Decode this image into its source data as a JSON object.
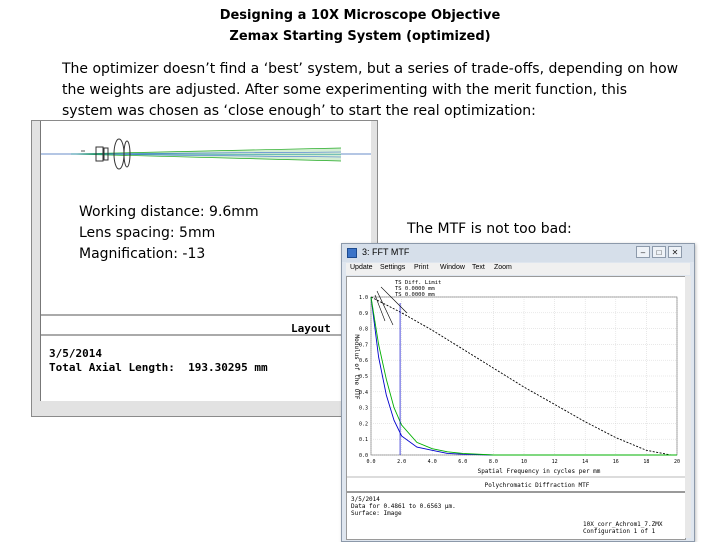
{
  "slide": {
    "title_line1": "Designing a 10X Microscope Objective",
    "title_line2": "Zemax Starting System (optimized)",
    "paragraph": "The optimizer doesn’t find a ‘best’ system, but a series of trade-offs, depending on how the weights are adjusted.  After some experimenting with the merit function, this system was chosen as ‘close enough’ to start the real optimization:",
    "specs": [
      "Working distance:  9.6mm",
      "Lens spacing:  5mm",
      "Magnification: -13"
    ],
    "mtf_caption": "The MTF is not too bad:"
  },
  "layout_window": {
    "label": "Layout",
    "date": "3/5/2014",
    "length_label": "Total Axial Length:",
    "length_value": "193.30295 mm"
  },
  "mtf_window": {
    "title": "3: FFT MTF",
    "menu": [
      "Update",
      "Settings",
      "Print",
      "Window",
      "Text",
      "Zoom"
    ],
    "controls": {
      "minimize": "–",
      "maximize": "□",
      "close": "✕"
    },
    "plot_title": "Polychromatic Diffraction MTF",
    "xlabel": "Spatial Frequency in cycles per mm",
    "ylabel": "Modulus of the OTF",
    "legend": [
      "TS Diff. Limit",
      "TS 0.0000 mm",
      "TS 0.0000 mm"
    ],
    "info": {
      "date": "3/5/2014",
      "line2": "Data for 0.4861 to 0.6563 µm.",
      "line3": "Surface: Image",
      "file": "10X_corr_Achrom1_7.ZMX",
      "config": "Configuration 1 of 1"
    }
  },
  "chart_data": {
    "type": "line",
    "title": "Polychromatic Diffraction MTF",
    "xlabel": "Spatial Frequency in cycles per mm",
    "ylabel": "Modulus of the OTF",
    "xlim": [
      0,
      20
    ],
    "ylim": [
      0,
      1
    ],
    "xticks": [
      "0.0",
      "2.0",
      "4.0",
      "6.0",
      "8.0",
      "10",
      "12",
      "14",
      "16",
      "18",
      "20"
    ],
    "yticks": [
      "0.0",
      "0.1",
      "0.2",
      "0.3",
      "0.4",
      "0.5",
      "0.6",
      "0.7",
      "0.8",
      "0.9",
      "1.0"
    ],
    "series": [
      {
        "name": "TS Diff. Limit",
        "color": "#000000",
        "style": "dashed",
        "x": [
          0,
          2,
          4,
          6,
          8,
          10,
          12,
          14,
          16,
          18,
          19.6
        ],
        "y": [
          1.0,
          0.9,
          0.79,
          0.67,
          0.55,
          0.43,
          0.32,
          0.21,
          0.11,
          0.03,
          0.0
        ]
      },
      {
        "name": "TS 0.0000 mm",
        "color": "#0000cc",
        "style": "solid",
        "x": [
          0,
          0.5,
          1,
          1.5,
          2,
          3,
          4,
          5,
          6,
          8,
          10,
          20
        ],
        "y": [
          1.0,
          0.62,
          0.38,
          0.22,
          0.12,
          0.05,
          0.03,
          0.01,
          0.005,
          0.0,
          0.0,
          0.0
        ]
      },
      {
        "name": "TS 0.0000 mm",
        "color": "#00b000",
        "style": "solid",
        "x": [
          0,
          0.5,
          1,
          1.5,
          2,
          3,
          4,
          5,
          6,
          8,
          10,
          20
        ],
        "y": [
          1.0,
          0.7,
          0.48,
          0.3,
          0.19,
          0.08,
          0.04,
          0.02,
          0.01,
          0.0,
          0.0,
          0.0
        ]
      }
    ]
  }
}
